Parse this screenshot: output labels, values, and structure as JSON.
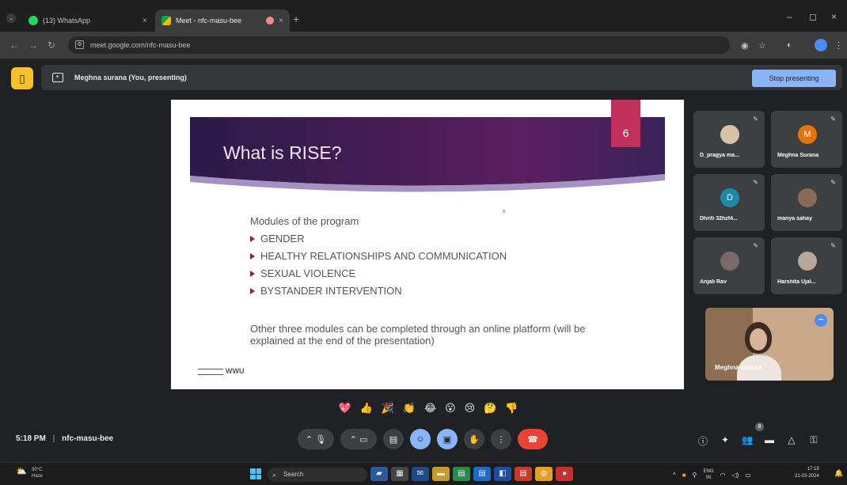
{
  "browser": {
    "tabs": [
      {
        "label": "(13) WhatsApp",
        "close": "×"
      },
      {
        "label": "Meet - nfc-masu-bee",
        "close": "×"
      }
    ],
    "new_tab": "+",
    "address": "meet.google.com/nfc-masu-bee",
    "window_controls": {
      "minimize": "–",
      "maximize": "◻",
      "close": "×"
    }
  },
  "meet": {
    "presenting_label": "Meghna surana (You, presenting)",
    "stop_button": "Stop presenting",
    "time": "5:18 PM",
    "separator": "|",
    "meeting_code": "nfc-masu-bee",
    "people_count": "8"
  },
  "slide": {
    "title": "What is RISE?",
    "number": "6",
    "intro": "Modules of the program",
    "modules": [
      "GENDER",
      "HEALTHY RELATIONSHIPS AND COMMUNICATION",
      "SEXUAL VIOLENCE",
      "BYSTANDER INTERVENTION"
    ],
    "footer": "Other three modules can be completed through an online platform (will be explained at the end of the presentation)",
    "logo_text": "WWU",
    "colors": {
      "band_dark": "#2b1a4a",
      "band_mid": "#5a1f5e",
      "accent": "#c0305b"
    }
  },
  "participants": [
    {
      "name": "D_pragya ma...",
      "initial": "",
      "color": "#d8c2a8"
    },
    {
      "name": "Meghna Surana",
      "initial": "M",
      "color": "#e8710a"
    },
    {
      "name": "Dhriti 32hzf4...",
      "initial": "D",
      "color": "#1e88a8"
    },
    {
      "name": "manya sahay",
      "initial": "",
      "color": "#8a6a55"
    },
    {
      "name": "Anjali Rav",
      "initial": "",
      "color": "#7a6a66"
    },
    {
      "name": "Harshita Ujal...",
      "initial": "",
      "color": "#b8a89a"
    }
  ],
  "self_view": {
    "name": "Meghna surana"
  },
  "reactions": [
    "💖",
    "👍",
    "🎉",
    "👏",
    "😂",
    "😮",
    "😢",
    "🤔",
    "👎"
  ],
  "taskbar": {
    "weather_temp": "30°C",
    "weather_desc": "Haze",
    "search": "Search",
    "lang": "ENG",
    "lang_sub": "IN",
    "clock_time": "17:18",
    "clock_date": "21-03-2024"
  }
}
